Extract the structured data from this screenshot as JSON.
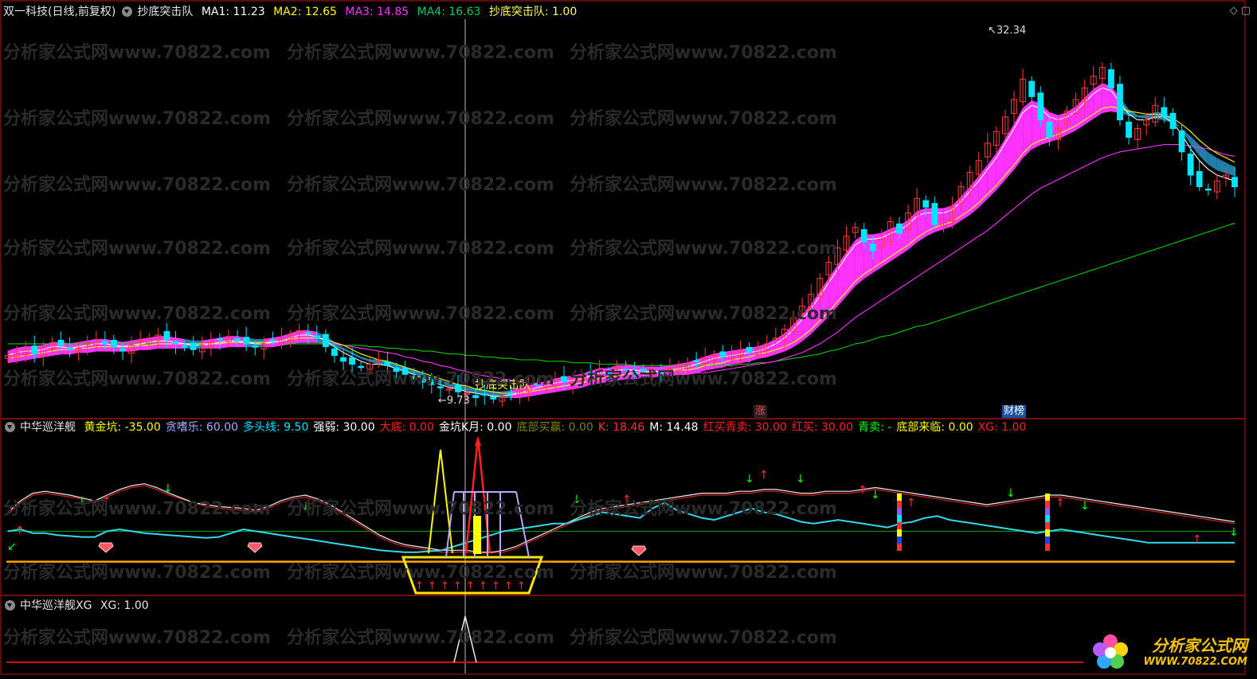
{
  "header": {
    "title": "双一科技(日线,前复权)",
    "indicator": "抄底突击队",
    "ma1": "MA1: 11.23",
    "ma2": "MA2: 12.65",
    "ma3": "MA3: 14.85",
    "ma4": "MA4: 16.63",
    "signal": "抄底突击队: 1.00"
  },
  "panel2": {
    "name": "中华巡洋舰",
    "items": [
      {
        "text": "黄金坑: -35.00",
        "color": "#ffff00"
      },
      {
        "text": "贪嗜乐: 60.00",
        "color": "#aaaaff"
      },
      {
        "text": "多头线: 9.50",
        "color": "#00e5ff"
      },
      {
        "text": "强弱: 30.00",
        "color": "#ffffff"
      },
      {
        "text": "大底: 0.00",
        "color": "#ff2020"
      },
      {
        "text": "金坑K月: 0.00",
        "color": "#ffffff"
      },
      {
        "text": "底部买赢: 0.00",
        "color": "#808000"
      },
      {
        "text": "K: 18.46",
        "color": "#ff3030"
      },
      {
        "text": "M: 14.48",
        "color": "#ffffff"
      },
      {
        "text": "红买青卖: 30.00",
        "color": "#ff2020"
      },
      {
        "text": "红买: 30.00",
        "color": "#ff2020"
      },
      {
        "text": "青卖: -",
        "color": "#00ff00"
      },
      {
        "text": "底部来临: 0.00",
        "color": "#ffff00"
      },
      {
        "text": "XG: 1.00",
        "color": "#ff2020"
      }
    ]
  },
  "panel3": {
    "name": "中华巡洋舰XG",
    "value": "XG: 1.00"
  },
  "annotations": {
    "high_label": "32.34",
    "low_label": "9.73",
    "signal_label": "抄底突击队",
    "tag_zhang": "涨",
    "tag_caibang": "财榜"
  },
  "watermark": "分析家公式网www.70822.com",
  "logo": {
    "line1": "分析家公式网",
    "line2": "WWW.70822.COM"
  },
  "colors": {
    "up": "#ff3b3b",
    "down": "#00e5ff",
    "ribbon_up": "#ff33ff",
    "ribbon_down": "#1f7fa8",
    "ma1": "#ffffff",
    "ma2": "#ffff00",
    "ma3": "#ff33ff",
    "ma4": "#00cc00"
  },
  "chart_data": {
    "type": "candlestick",
    "count": 140,
    "price_range": [
      8,
      34
    ],
    "close": [
      11.2,
      11.4,
      11.6,
      11.3,
      11.8,
      12.0,
      11.9,
      11.6,
      11.7,
      12.1,
      12.3,
      12.0,
      11.8,
      11.5,
      11.9,
      12.2,
      12.4,
      12.6,
      12.3,
      12.0,
      11.8,
      11.6,
      11.9,
      12.1,
      12.3,
      12.5,
      12.2,
      12.0,
      11.8,
      12.0,
      12.2,
      12.4,
      12.6,
      12.9,
      12.7,
      12.4,
      11.8,
      11.2,
      10.8,
      10.6,
      10.4,
      10.6,
      10.9,
      10.5,
      10.1,
      9.9,
      9.6,
      9.4,
      9.2,
      9.0,
      8.9,
      8.7,
      8.6,
      8.3,
      8.5,
      8.2,
      8.4,
      8.6,
      8.9,
      9.0,
      9.2,
      9.3,
      9.5,
      9.4,
      9.6,
      9.8,
      10.0,
      10.2,
      10.0,
      10.4,
      10.2,
      10.0,
      10.1,
      10.2,
      10.0,
      10.3,
      10.5,
      10.6,
      10.8,
      11.0,
      11.2,
      11.1,
      11.3,
      11.5,
      11.4,
      11.7,
      12.0,
      12.4,
      13.0,
      13.8,
      14.6,
      15.4,
      16.5,
      17.6,
      18.6,
      19.4,
      20.0,
      19.0,
      18.4,
      19.2,
      20.4,
      19.6,
      21.0,
      22.0,
      21.4,
      20.2,
      20.6,
      21.4,
      22.8,
      23.8,
      24.6,
      25.8,
      26.6,
      27.6,
      28.8,
      30.2,
      29.0,
      27.4,
      26.2,
      26.8,
      28.0,
      28.8,
      29.6,
      30.4,
      31.0,
      29.6,
      27.4,
      26.2,
      26.8,
      27.4,
      28.4,
      27.6,
      26.8,
      25.2,
      23.6,
      22.8,
      22.6,
      23.2,
      23.6,
      22.8
    ],
    "ma1": [
      11.2,
      11.4,
      11.5,
      11.5,
      11.6,
      11.8,
      11.8,
      11.7,
      11.8,
      11.9,
      12.0,
      12.0,
      11.9,
      11.8,
      11.9,
      12.0,
      12.1,
      12.2,
      12.2,
      12.1,
      12.0,
      11.9,
      11.9,
      12.0,
      12.1,
      12.2,
      12.2,
      12.1,
      12.0,
      12.0,
      12.1,
      12.2,
      12.4,
      12.6,
      12.6,
      12.5,
      12.2,
      11.8,
      11.4,
      11.1,
      10.8,
      10.6,
      10.6,
      10.5,
      10.3,
      10.1,
      9.9,
      9.6,
      9.4,
      9.2,
      9.0,
      8.9,
      8.7,
      8.6,
      8.5,
      8.4,
      8.4,
      8.5,
      8.6,
      8.8,
      9.0,
      9.1,
      9.3,
      9.4,
      9.5,
      9.6,
      9.8,
      10.0,
      10.0,
      10.2,
      10.2,
      10.2,
      10.1,
      10.1,
      10.1,
      10.2,
      10.3,
      10.4,
      10.6,
      10.8,
      11.0,
      11.1,
      11.2,
      11.3,
      11.4,
      11.5,
      11.7,
      12.0,
      12.4,
      13.0,
      13.7,
      14.4,
      15.3,
      16.2,
      17.1,
      18.0,
      18.8,
      19.2,
      19.2,
      19.3,
      19.6,
      19.8,
      20.2,
      20.8,
      21.0,
      21.0,
      21.0,
      21.2,
      21.8,
      22.5,
      23.2,
      24.0,
      24.8,
      25.8,
      26.8,
      27.9,
      28.4,
      28.2,
      27.6,
      27.4,
      27.6,
      28.0,
      28.6,
      29.2,
      29.6,
      29.4,
      28.6,
      27.8,
      27.4,
      27.4,
      27.6,
      27.6,
      27.2,
      26.4,
      25.4,
      24.6,
      24.0,
      23.6,
      23.4,
      23.2
    ],
    "ma2": [
      11.0,
      11.1,
      11.2,
      11.3,
      11.4,
      11.5,
      11.6,
      11.6,
      11.7,
      11.7,
      11.8,
      11.8,
      11.8,
      11.8,
      11.8,
      11.9,
      11.9,
      12.0,
      12.0,
      12.0,
      12.0,
      12.0,
      12.0,
      12.0,
      12.0,
      12.1,
      12.1,
      12.1,
      12.1,
      12.1,
      12.1,
      12.2,
      12.3,
      12.4,
      12.4,
      12.4,
      12.3,
      12.1,
      11.9,
      11.6,
      11.3,
      11.1,
      10.9,
      10.8,
      10.6,
      10.4,
      10.2,
      10.0,
      9.8,
      9.6,
      9.4,
      9.2,
      9.1,
      8.9,
      8.8,
      8.7,
      8.6,
      8.6,
      8.6,
      8.7,
      8.8,
      8.9,
      9.0,
      9.1,
      9.2,
      9.3,
      9.5,
      9.6,
      9.7,
      9.8,
      9.9,
      10.0,
      10.0,
      10.1,
      10.1,
      10.1,
      10.2,
      10.2,
      10.3,
      10.5,
      10.6,
      10.7,
      10.9,
      11.0,
      11.1,
      11.3,
      11.4,
      11.6,
      11.8,
      12.1,
      12.5,
      13.0,
      13.6,
      14.2,
      14.9,
      15.6,
      16.3,
      16.8,
      17.2,
      17.6,
      18.0,
      18.4,
      18.8,
      19.3,
      19.7,
      20.0,
      20.2,
      20.4,
      20.8,
      21.2,
      21.7,
      22.3,
      22.9,
      23.6,
      24.3,
      25.1,
      25.7,
      26.0,
      26.2,
      26.4,
      26.7,
      27.0,
      27.4,
      27.8,
      28.2,
      28.3,
      28.2,
      28.0,
      27.9,
      27.8,
      27.8,
      27.7,
      27.5,
      27.1,
      26.6,
      26.0,
      25.5,
      25.1,
      24.8,
      24.5
    ],
    "ma3": [
      11.5,
      11.5,
      11.6,
      11.6,
      11.6,
      11.7,
      11.7,
      11.7,
      11.7,
      11.7,
      11.8,
      11.8,
      11.8,
      11.8,
      11.8,
      11.8,
      11.8,
      11.8,
      11.9,
      11.9,
      11.9,
      11.9,
      11.9,
      11.9,
      12.0,
      12.0,
      12.0,
      12.0,
      12.0,
      12.0,
      12.0,
      12.0,
      12.1,
      12.1,
      12.1,
      12.1,
      12.1,
      12.0,
      11.9,
      11.8,
      11.7,
      11.6,
      11.5,
      11.4,
      11.3,
      11.1,
      11.0,
      10.8,
      10.7,
      10.5,
      10.4,
      10.2,
      10.1,
      9.9,
      9.8,
      9.7,
      9.6,
      9.5,
      9.4,
      9.3,
      9.3,
      9.3,
      9.3,
      9.3,
      9.3,
      9.3,
      9.4,
      9.4,
      9.5,
      9.5,
      9.6,
      9.6,
      9.7,
      9.7,
      9.8,
      9.8,
      9.9,
      9.9,
      10.0,
      10.0,
      10.1,
      10.2,
      10.3,
      10.4,
      10.5,
      10.6,
      10.7,
      10.8,
      11.0,
      11.2,
      11.4,
      11.7,
      12.0,
      12.4,
      12.8,
      13.3,
      13.8,
      14.2,
      14.6,
      15.0,
      15.4,
      15.8,
      16.2,
      16.6,
      17.0,
      17.4,
      17.8,
      18.2,
      18.6,
      19.0,
      19.4,
      19.8,
      20.3,
      20.8,
      21.3,
      21.8,
      22.3,
      22.7,
      23.0,
      23.3,
      23.6,
      23.9,
      24.2,
      24.5,
      24.8,
      25.0,
      25.2,
      25.3,
      25.4,
      25.5,
      25.6,
      25.7,
      25.7,
      25.7,
      25.6,
      25.5,
      25.4,
      25.2,
      25.0,
      24.9
    ],
    "ma4": [
      12.0,
      12.0,
      12.0,
      12.0,
      12.0,
      12.0,
      12.0,
      12.0,
      12.0,
      12.0,
      12.0,
      12.0,
      12.0,
      12.0,
      12.0,
      12.0,
      12.0,
      12.0,
      12.0,
      12.0,
      12.0,
      12.0,
      12.0,
      12.0,
      12.0,
      12.0,
      12.0,
      12.0,
      12.0,
      12.0,
      12.0,
      12.0,
      12.0,
      12.0,
      12.0,
      12.0,
      12.0,
      12.0,
      11.9,
      11.9,
      11.9,
      11.8,
      11.8,
      11.7,
      11.7,
      11.6,
      11.6,
      11.5,
      11.5,
      11.4,
      11.3,
      11.3,
      11.2,
      11.2,
      11.1,
      11.1,
      11.0,
      11.0,
      10.9,
      10.9,
      10.9,
      10.8,
      10.8,
      10.8,
      10.7,
      10.7,
      10.7,
      10.6,
      10.6,
      10.6,
      10.6,
      10.5,
      10.5,
      10.5,
      10.5,
      10.5,
      10.5,
      10.5,
      10.5,
      10.5,
      10.5,
      10.5,
      10.5,
      10.6,
      10.6,
      10.7,
      10.7,
      10.8,
      10.9,
      11.0,
      11.1,
      11.2,
      11.3,
      11.5,
      11.6,
      11.8,
      12.0,
      12.1,
      12.3,
      12.5,
      12.6,
      12.8,
      13.0,
      13.2,
      13.3,
      13.5,
      13.7,
      13.9,
      14.1,
      14.3,
      14.5,
      14.7,
      14.9,
      15.1,
      15.3,
      15.5,
      15.7,
      15.9,
      16.1,
      16.3,
      16.5,
      16.7,
      16.9,
      17.1,
      17.3,
      17.5,
      17.7,
      17.9,
      18.1,
      18.3,
      18.5,
      18.7,
      18.9,
      19.1,
      19.3,
      19.5,
      19.7,
      19.9,
      20.1,
      20.3
    ],
    "osc_range": [
      -45,
      120
    ],
    "osc_white": [
      40,
      52,
      60,
      62,
      60,
      58,
      55,
      52,
      58,
      64,
      68,
      70,
      66,
      60,
      55,
      50,
      48,
      46,
      45,
      44,
      42,
      46,
      52,
      56,
      58,
      54,
      48,
      40,
      32,
      24,
      16,
      10,
      6,
      4,
      2,
      0,
      0,
      0,
      -2,
      -2,
      0,
      4,
      10,
      16,
      22,
      28,
      34,
      40,
      44,
      46,
      48,
      50,
      52,
      54,
      56,
      58,
      60,
      60,
      60,
      62,
      62,
      64,
      64,
      62,
      60,
      60,
      62,
      62,
      62,
      64,
      66,
      64,
      62,
      60,
      58,
      56,
      54,
      52,
      50,
      48,
      50,
      52,
      54,
      56,
      58,
      58,
      56,
      54,
      52,
      50,
      48,
      46,
      44,
      42,
      40,
      38,
      36,
      34,
      32,
      30
    ],
    "osc_red": [
      38,
      50,
      58,
      60,
      58,
      56,
      54,
      50,
      56,
      62,
      66,
      68,
      64,
      58,
      54,
      50,
      46,
      44,
      43,
      42,
      40,
      44,
      50,
      54,
      56,
      52,
      46,
      38,
      30,
      22,
      14,
      8,
      4,
      2,
      0,
      -2,
      -2,
      -2,
      -3,
      -3,
      -2,
      2,
      8,
      14,
      20,
      26,
      32,
      38,
      42,
      44,
      46,
      48,
      50,
      52,
      54,
      56,
      58,
      58,
      58,
      60,
      60,
      62,
      62,
      60,
      58,
      58,
      60,
      60,
      60,
      62,
      64,
      62,
      60,
      58,
      56,
      54,
      52,
      50,
      48,
      46,
      48,
      50,
      52,
      54,
      56,
      56,
      54,
      52,
      50,
      48,
      46,
      44,
      42,
      40,
      38,
      36,
      34,
      32,
      30,
      28
    ],
    "osc_cyan": [
      20,
      22,
      18,
      18,
      16,
      15,
      14,
      14,
      20,
      22,
      20,
      18,
      17,
      16,
      15,
      14,
      13,
      14,
      18,
      22,
      20,
      18,
      16,
      14,
      12,
      10,
      8,
      6,
      4,
      2,
      0,
      -1,
      -2,
      -2,
      -1,
      0,
      4,
      8,
      12,
      16,
      20,
      22,
      24,
      26,
      28,
      28,
      32,
      36,
      40,
      38,
      36,
      34,
      44,
      50,
      42,
      38,
      34,
      32,
      36,
      40,
      44,
      40,
      38,
      34,
      30,
      28,
      30,
      32,
      30,
      28,
      26,
      24,
      28,
      30,
      34,
      36,
      32,
      30,
      28,
      26,
      24,
      22,
      20,
      18,
      20,
      22,
      20,
      18,
      16,
      14,
      12,
      10,
      8,
      8,
      8,
      8,
      8,
      8,
      8,
      8
    ],
    "osc_green_level": 20,
    "osc_orange_level": -12
  }
}
